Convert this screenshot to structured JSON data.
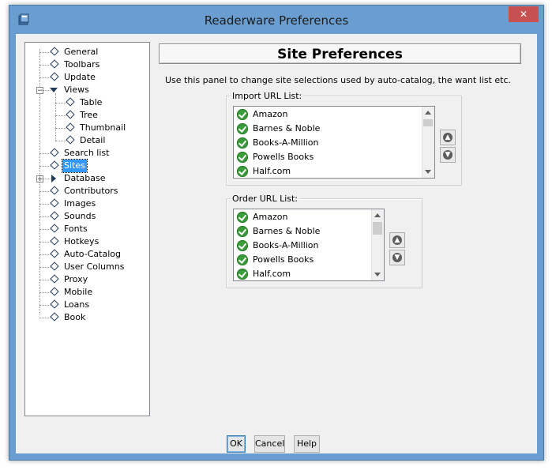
{
  "window": {
    "title": "Readerware Preferences",
    "close_glyph": "✕"
  },
  "tree": {
    "items": [
      {
        "label": "General",
        "level": 0
      },
      {
        "label": "Toolbars",
        "level": 0
      },
      {
        "label": "Update",
        "level": 0
      },
      {
        "label": "Views",
        "level": 0,
        "expanded": true
      },
      {
        "label": "Table",
        "level": 1
      },
      {
        "label": "Tree",
        "level": 1
      },
      {
        "label": "Thumbnail",
        "level": 1
      },
      {
        "label": "Detail",
        "level": 1
      },
      {
        "label": "Search list",
        "level": 0
      },
      {
        "label": "Sites",
        "level": 0,
        "selected": true
      },
      {
        "label": "Database",
        "level": 0,
        "collapsed": true
      },
      {
        "label": "Contributors",
        "level": 0
      },
      {
        "label": "Images",
        "level": 0
      },
      {
        "label": "Sounds",
        "level": 0
      },
      {
        "label": "Fonts",
        "level": 0
      },
      {
        "label": "Hotkeys",
        "level": 0
      },
      {
        "label": "Auto-Catalog",
        "level": 0
      },
      {
        "label": "User Columns",
        "level": 0
      },
      {
        "label": "Proxy",
        "level": 0
      },
      {
        "label": "Mobile",
        "level": 0
      },
      {
        "label": "Loans",
        "level": 0
      },
      {
        "label": "Book",
        "level": 0
      }
    ]
  },
  "panel": {
    "title": "Site Preferences",
    "description": "Use this panel to change site selections used by auto-catalog, the want list etc."
  },
  "import_list": {
    "label": "Import URL List:",
    "items": [
      "Amazon",
      "Barnes & Noble",
      "Books-A-Million",
      "Powells Books",
      "Half.com"
    ]
  },
  "order_list": {
    "label": "Order URL List:",
    "items": [
      "Amazon",
      "Barnes & Noble",
      "Books-A-Million",
      "Powells Books",
      "Half.com"
    ]
  },
  "buttons": {
    "ok": "OK",
    "cancel": "Cancel",
    "help": "Help"
  },
  "colors": {
    "window_frame": "#6a9ed0",
    "close": "#c75050",
    "selection": "#3399ff",
    "check": "#3a9b3a"
  }
}
